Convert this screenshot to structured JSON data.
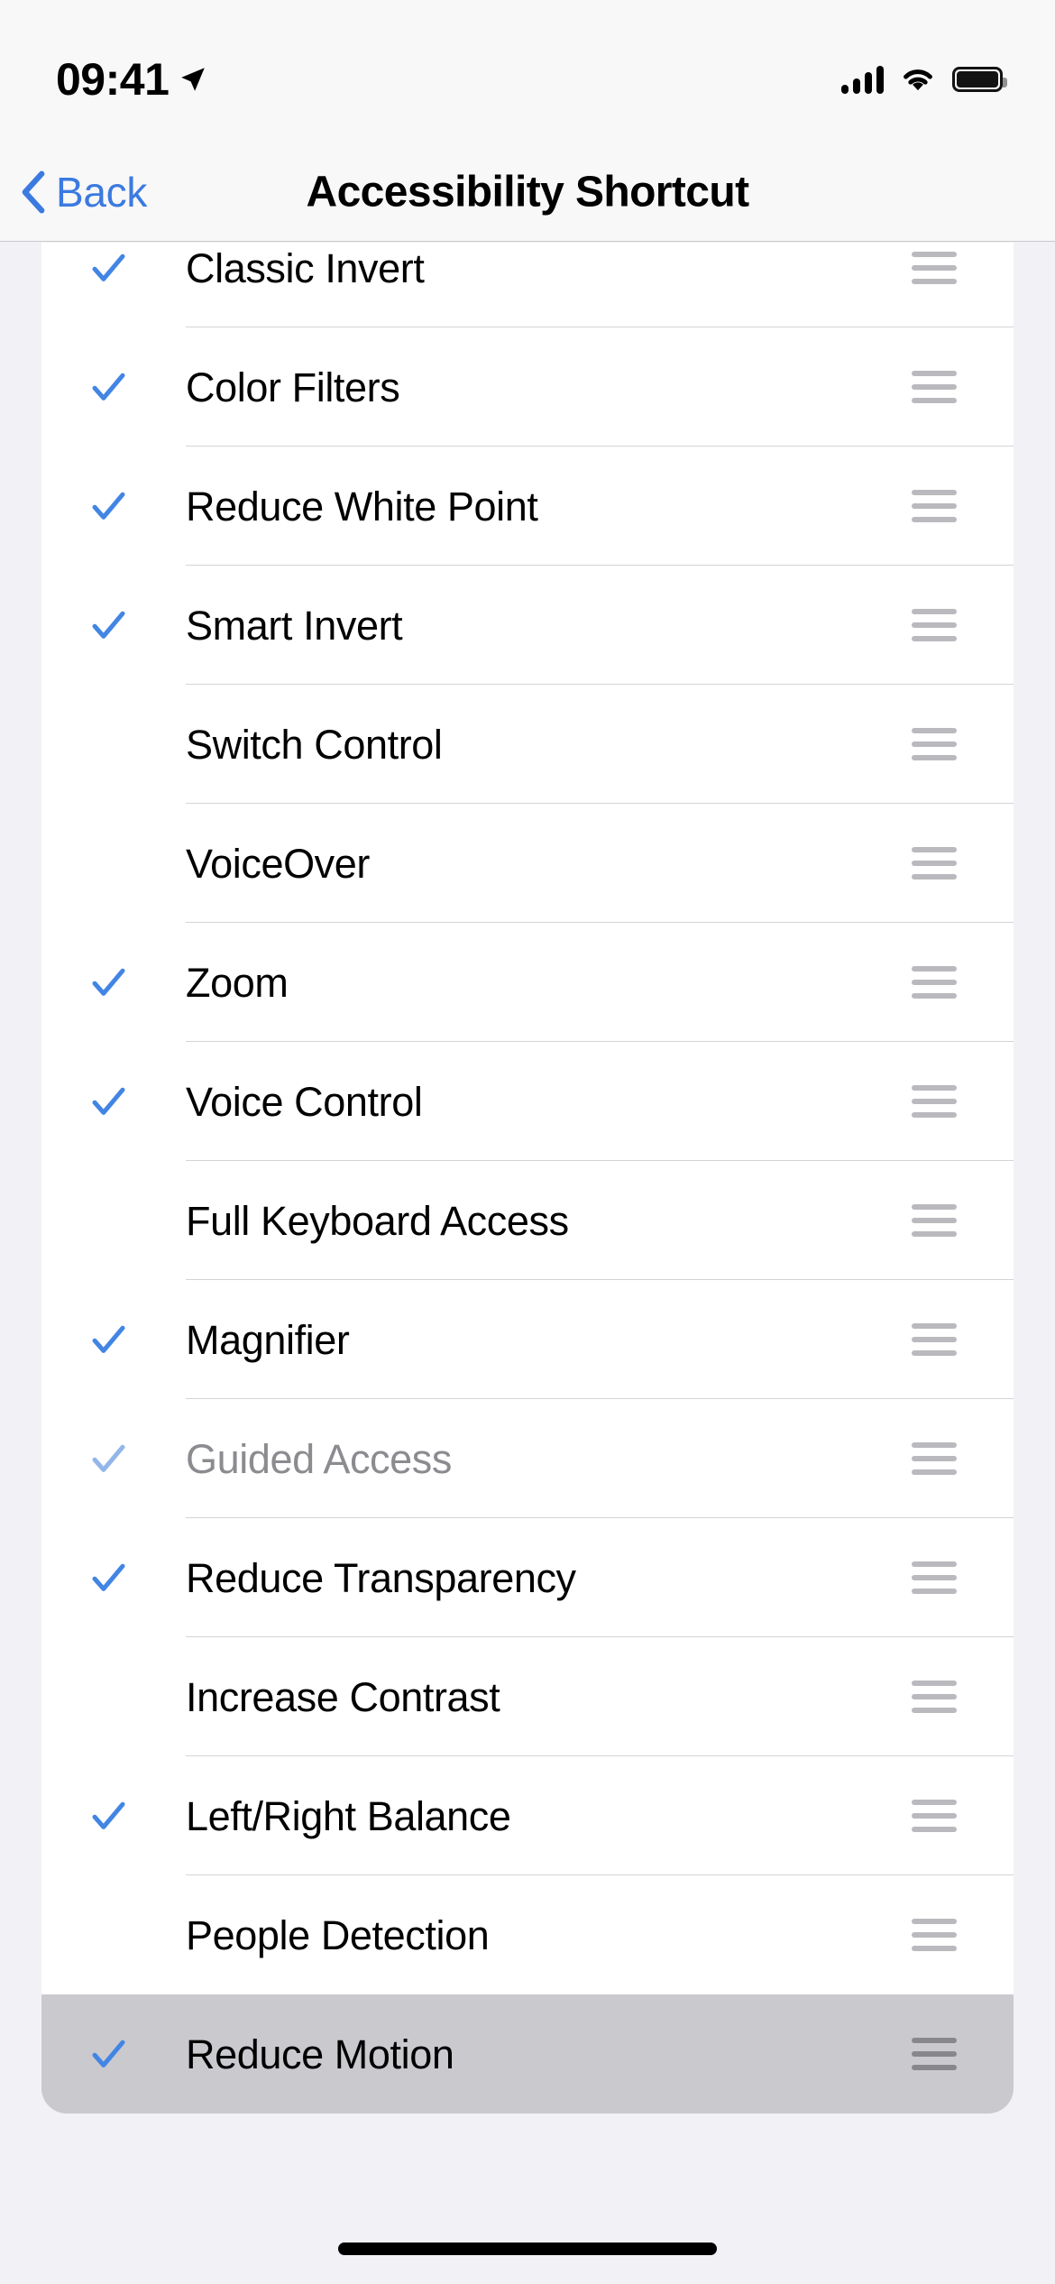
{
  "status_bar": {
    "time": "09:41",
    "location_icon": "location-arrow-icon",
    "cellular_icon": "cellular-signal-icon",
    "wifi_icon": "wifi-icon",
    "battery_icon": "battery-full-icon"
  },
  "nav": {
    "back_label": "Back",
    "back_icon": "chevron-left-icon",
    "title": "Accessibility Shortcut"
  },
  "colors": {
    "accent_blue": "#3b7ae0",
    "check_blue": "#4285e4",
    "check_blue_dim": "#93b6ea",
    "page_background": "#f2f1f6",
    "card_background": "#ffffff",
    "selected_row_background": "#c9c9ce",
    "separator": "#d4d4d8",
    "handle_grey": "#b9b9be",
    "dimmed_text": "#8b8b90"
  },
  "list": {
    "reorder_handle_icon": "reorder-handle-icon",
    "checkmark_icon": "checkmark-icon",
    "rows": [
      {
        "label": "Classic Invert",
        "checked": true,
        "dimmed": false,
        "selected": false,
        "separator": true
      },
      {
        "label": "Color Filters",
        "checked": true,
        "dimmed": false,
        "selected": false,
        "separator": true
      },
      {
        "label": "Reduce White Point",
        "checked": true,
        "dimmed": false,
        "selected": false,
        "separator": true
      },
      {
        "label": "Smart Invert",
        "checked": true,
        "dimmed": false,
        "selected": false,
        "separator": true
      },
      {
        "label": "Switch Control",
        "checked": false,
        "dimmed": false,
        "selected": false,
        "separator": true
      },
      {
        "label": "VoiceOver",
        "checked": false,
        "dimmed": false,
        "selected": false,
        "separator": true
      },
      {
        "label": "Zoom",
        "checked": true,
        "dimmed": false,
        "selected": false,
        "separator": true
      },
      {
        "label": "Voice Control",
        "checked": true,
        "dimmed": false,
        "selected": false,
        "separator": true
      },
      {
        "label": "Full Keyboard Access",
        "checked": false,
        "dimmed": false,
        "selected": false,
        "separator": true
      },
      {
        "label": "Magnifier",
        "checked": true,
        "dimmed": false,
        "selected": false,
        "separator": true
      },
      {
        "label": "Guided Access",
        "checked": true,
        "dimmed": true,
        "selected": false,
        "separator": true
      },
      {
        "label": "Reduce Transparency",
        "checked": true,
        "dimmed": false,
        "selected": false,
        "separator": true
      },
      {
        "label": "Increase Contrast",
        "checked": false,
        "dimmed": false,
        "selected": false,
        "separator": true
      },
      {
        "label": "Left/Right Balance",
        "checked": true,
        "dimmed": false,
        "selected": false,
        "separator": true
      },
      {
        "label": "People Detection",
        "checked": false,
        "dimmed": false,
        "selected": false,
        "separator": false
      },
      {
        "label": "Reduce Motion",
        "checked": true,
        "dimmed": false,
        "selected": true,
        "separator": false
      }
    ]
  },
  "home_indicator": "home-indicator"
}
